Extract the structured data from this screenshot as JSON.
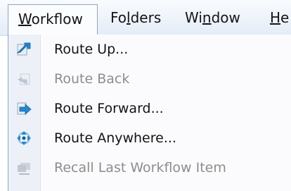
{
  "menubar": {
    "items": [
      {
        "label": "Workflow",
        "mnemonic": "W",
        "rest": "orkflow",
        "active": true
      },
      {
        "label": "Folders",
        "pre": "Fo",
        "mnemonic": "l",
        "rest": "ders"
      },
      {
        "label": "Window",
        "pre": "Wi",
        "mnemonic": "n",
        "rest": "dow"
      },
      {
        "label": "He",
        "mnemonic": "H",
        "rest": "e"
      }
    ]
  },
  "menu": {
    "items": [
      {
        "label": "Route Up...",
        "icon": "route-up-icon",
        "enabled": true
      },
      {
        "label": "Route Back",
        "icon": "route-back-icon",
        "enabled": false
      },
      {
        "label": "Route Forward...",
        "icon": "route-forward-icon",
        "enabled": true
      },
      {
        "label": "Route Anywhere...",
        "icon": "route-anywhere-icon",
        "enabled": true
      },
      {
        "label": "Recall Last Workflow Item",
        "icon": "recall-icon",
        "enabled": false
      }
    ]
  },
  "colors": {
    "accent": "#8da6c8",
    "icon_blue": "#1e8ad6",
    "disabled_text": "#8d8d8d"
  }
}
